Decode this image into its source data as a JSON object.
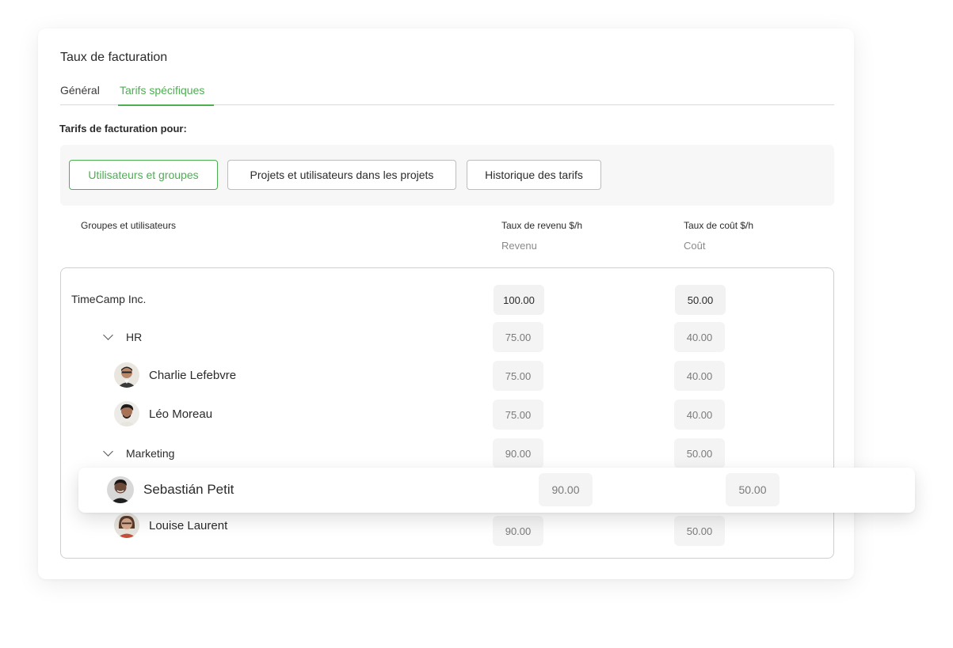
{
  "panel": {
    "title": "Taux de facturation",
    "tabs": [
      {
        "label": "Général",
        "active": false
      },
      {
        "label": "Tarifs spécifiques",
        "active": true
      }
    ],
    "subheading": "Tarifs de facturation pour:"
  },
  "filters": [
    {
      "label": "Utilisateurs et groupes",
      "active": true
    },
    {
      "label": "Projets et utilisateurs dans les projets",
      "active": false
    },
    {
      "label": "Historique des tarifs",
      "active": false
    }
  ],
  "columns": {
    "name": "Groupes et utilisateurs",
    "revenue": "Taux de revenu $/h",
    "revenue_sub": "Revenu",
    "cost": "Taux de coût $/h",
    "cost_sub": "Coût"
  },
  "rows": [
    {
      "name": "TimeCamp Inc.",
      "type": "company",
      "revenue": "100.00",
      "cost": "50.00"
    },
    {
      "name": "HR",
      "type": "group",
      "revenue": "75.00",
      "cost": "40.00"
    },
    {
      "name": "Charlie Lefebvre",
      "type": "user",
      "revenue": "75.00",
      "cost": "40.00"
    },
    {
      "name": "Léo Moreau",
      "type": "user",
      "revenue": "75.00",
      "cost": "40.00"
    },
    {
      "name": "Marketing",
      "type": "group",
      "revenue": "90.00",
      "cost": "50.00"
    },
    {
      "name": "Sebastián Petit",
      "type": "user",
      "revenue": "90.00",
      "cost": "50.00",
      "highlighted": true
    },
    {
      "name": "Louise Laurent",
      "type": "user",
      "revenue": "90.00",
      "cost": "50.00"
    }
  ],
  "colors": {
    "accent": "#4caf50",
    "border": "#cfcfcf",
    "field_bg": "#f4f4f4"
  },
  "icons": {
    "group_toggle": "chevron-down-icon",
    "user": "avatar"
  }
}
